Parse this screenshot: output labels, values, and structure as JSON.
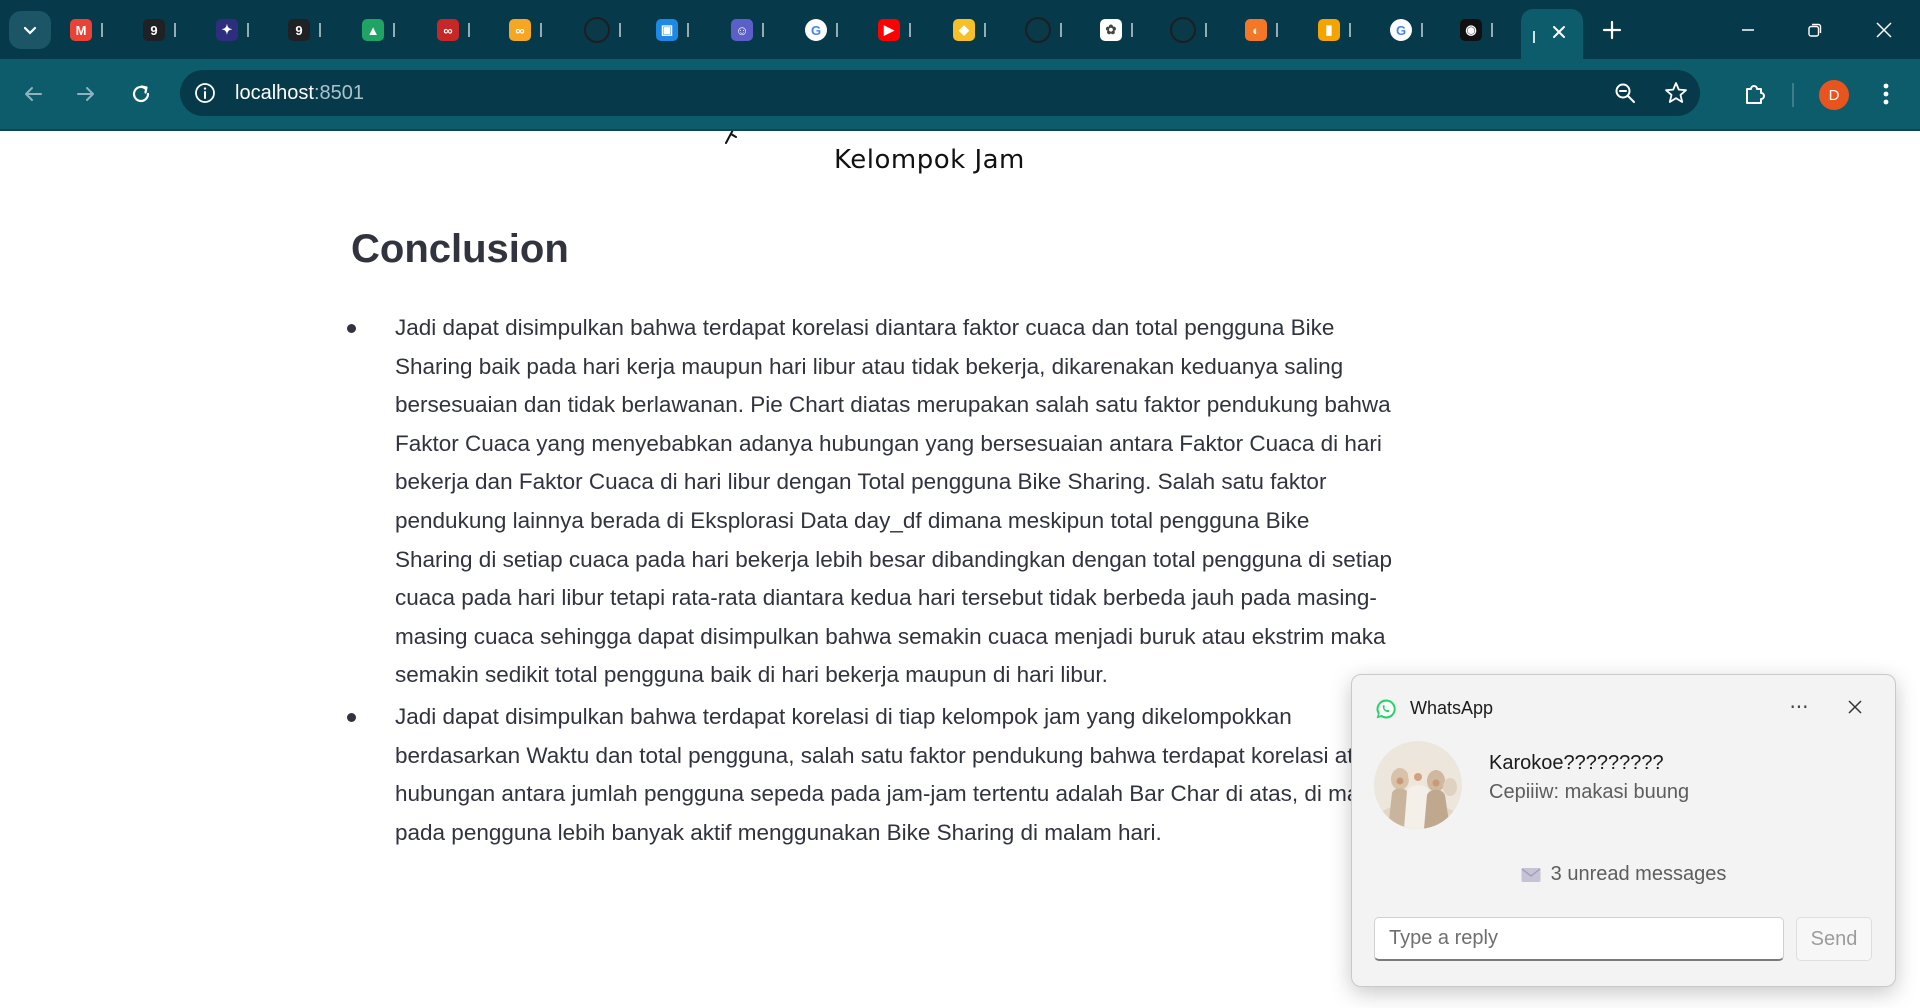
{
  "browser": {
    "tabs": [
      {
        "icon": "gmail-icon",
        "color": "#ea4335",
        "glyph": "M"
      },
      {
        "icon": "g9-icon",
        "color": "#202124",
        "glyph": "9"
      },
      {
        "icon": "spark-icon",
        "color": "#2d2f7e",
        "glyph": "✦"
      },
      {
        "icon": "g9-icon",
        "color": "#202124",
        "glyph": "9"
      },
      {
        "icon": "google-drive-icon",
        "color": "#1fa463",
        "glyph": "▲"
      },
      {
        "icon": "infinity-red-icon",
        "color": "#c62828",
        "glyph": "∞"
      },
      {
        "icon": "infinity-orange-icon",
        "color": "#f5a623",
        "glyph": "∞"
      },
      {
        "icon": "github-icon",
        "color": "#1b1f23",
        "glyph": "●"
      },
      {
        "icon": "google-classroom-icon",
        "color": "#1e88e5",
        "glyph": "▣"
      },
      {
        "icon": "bot-icon",
        "color": "#5b5fc7",
        "glyph": "☺"
      },
      {
        "icon": "google-icon",
        "color": "#ffffff",
        "glyph": "G"
      },
      {
        "icon": "youtube-icon",
        "color": "#ff0000",
        "glyph": "▶"
      },
      {
        "icon": "scholar-icon",
        "color": "#f6c026",
        "glyph": "◆"
      },
      {
        "icon": "github-icon",
        "color": "#1b1f23",
        "glyph": "●"
      },
      {
        "icon": "openai-icon",
        "color": "#ffffff",
        "glyph": "✿"
      },
      {
        "icon": "github-icon",
        "color": "#1b1f23",
        "glyph": "●"
      },
      {
        "icon": "jupyter-icon",
        "color": "#f37726",
        "glyph": "◐"
      },
      {
        "icon": "book-icon",
        "color": "#f4a300",
        "glyph": "▮"
      },
      {
        "icon": "google-icon",
        "color": "#ffffff",
        "glyph": "G"
      },
      {
        "icon": "copilot-icon",
        "color": "#111111",
        "glyph": "◉"
      }
    ],
    "url_host": "localhost",
    "url_port": ":8501",
    "profile_initial": "D"
  },
  "page": {
    "x_axis_label": "Kelompok Jam",
    "conclusion_heading": "Conclusion",
    "bullets": [
      "Jadi dapat disimpulkan bahwa terdapat korelasi diantara faktor cuaca dan total pengguna Bike Sharing baik pada hari kerja maupun hari libur atau tidak bekerja, dikarenakan keduanya saling bersesuaian dan tidak berlawanan. Pie Chart diatas merupakan salah satu faktor pendukung bahwa Faktor Cuaca yang menyebabkan adanya hubungan yang bersesuaian antara Faktor Cuaca di hari bekerja dan Faktor Cuaca di hari libur dengan Total pengguna Bike Sharing. Salah satu faktor pendukung lainnya berada di Eksplorasi Data day_df dimana meskipun total pengguna Bike Sharing di setiap cuaca pada hari bekerja lebih besar dibandingkan dengan total pengguna di setiap cuaca pada hari libur tetapi rata-rata diantara kedua hari tersebut tidak berbeda jauh pada masing-masing cuaca sehingga dapat disimpulkan bahwa semakin cuaca menjadi buruk atau ekstrim maka semakin sedikit total pengguna baik di hari bekerja maupun di hari libur.",
      "Jadi dapat disimpulkan bahwa terdapat korelasi di tiap kelompok jam yang dikelompokkan berdasarkan Waktu dan total pengguna, salah satu faktor pendukung bahwa terdapat korelasi atau hubungan antara jumlah pengguna sepeda pada jam-jam tertentu adalah Bar Char di atas, di mana pada pengguna lebih banyak aktif menggunakan Bike Sharing di malam hari."
    ]
  },
  "notification": {
    "app_name": "WhatsApp",
    "more_label": "···",
    "title": "Karokoe?????????",
    "message": "Cepiiiw: makasi buung",
    "unread": "3 unread messages",
    "reply_placeholder": "Type a reply",
    "send_label": "Send",
    "accent": "#25d366"
  }
}
